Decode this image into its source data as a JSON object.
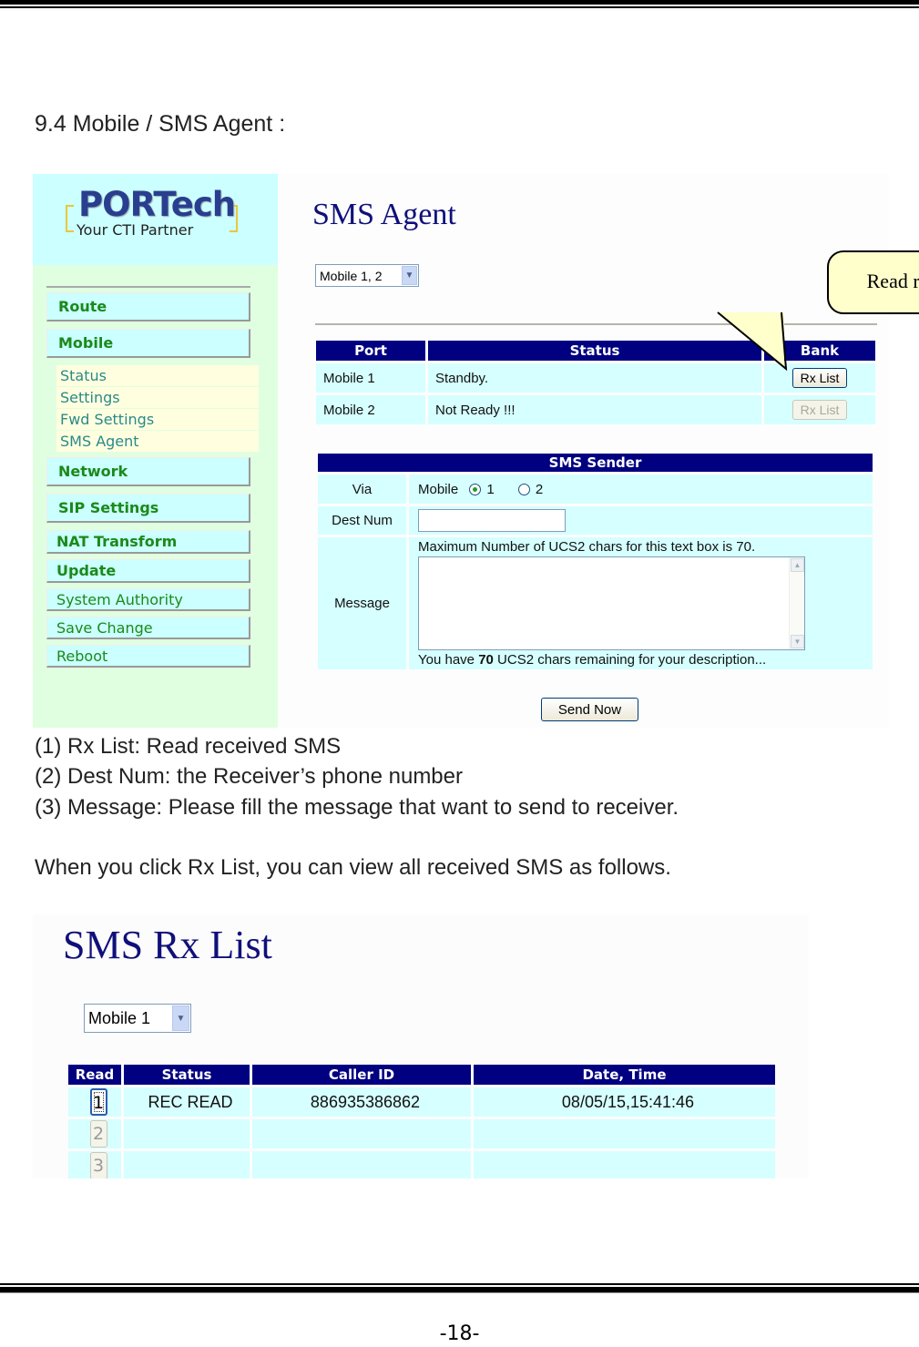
{
  "section_title": "9.4 Mobile / SMS Agent :",
  "sms_agent_screen": {
    "logo": {
      "brand": "PORTech",
      "tagline": "Your CTI Partner"
    },
    "sidebar": {
      "items": [
        {
          "label": "Route"
        },
        {
          "label": "Mobile"
        },
        {
          "label": "Network"
        },
        {
          "label": "SIP Settings"
        },
        {
          "label": "NAT Transform"
        },
        {
          "label": "Update"
        },
        {
          "label": "System Authority"
        },
        {
          "label": "Save Change"
        },
        {
          "label": "Reboot"
        }
      ],
      "mobile_submenu": [
        {
          "label": "Status"
        },
        {
          "label": "Settings"
        },
        {
          "label": "Fwd Settings"
        },
        {
          "label": "SMS Agent"
        }
      ]
    },
    "title": "SMS Agent",
    "port_select": {
      "value": "Mobile 1, 2"
    },
    "callout": "Read received SMS",
    "port_table": {
      "headers": [
        "Port",
        "Status",
        "Bank"
      ],
      "rows": [
        {
          "port": "Mobile 1",
          "status": "Standby.",
          "button": "Rx List",
          "enabled": true
        },
        {
          "port": "Mobile 2",
          "status": "Not Ready !!!",
          "button": "Rx List",
          "enabled": false
        }
      ]
    },
    "sender": {
      "header": "SMS Sender",
      "via_label": "Via",
      "via_prefix": "Mobile",
      "via_options": [
        "1",
        "2"
      ],
      "via_selected": "1",
      "dest_label": "Dest Num",
      "dest_value": "",
      "message_label": "Message",
      "message_hint": "Maximum Number of UCS2 chars for this text box is 70.",
      "message_value": "",
      "remaining_prefix": "You have ",
      "remaining_count": "70",
      "remaining_suffix": " UCS2 chars remaining for your description...",
      "send_button": "Send Now"
    }
  },
  "descriptions": [
    "(1) Rx List: Read received SMS",
    "(2) Dest Num: the Receiver’s phone number",
    "(3) Message: Please fill the message that want to send to receiver."
  ],
  "followup": "When you click Rx List, you can view all received SMS as follows.",
  "rx_list_screen": {
    "title": "SMS Rx List",
    "port_select": {
      "value": "Mobile 1"
    },
    "headers": [
      "Read",
      "Status",
      "Caller ID",
      "Date, Time"
    ],
    "rows": [
      {
        "read": "1",
        "status": "REC READ",
        "caller_id": "886935386862",
        "datetime": "08/05/15,15:41:46"
      },
      {
        "read": "2",
        "status": "",
        "caller_id": "",
        "datetime": ""
      },
      {
        "read": "3",
        "status": "",
        "caller_id": "",
        "datetime": ""
      }
    ]
  },
  "page_number": "-18-",
  "colors": {
    "header_navy": "#000080",
    "cell_cyan": "#d6ffff",
    "sidebar_green": "#e0ffe0",
    "nav_text_green": "#1a8a1a",
    "title_navy": "#10107a",
    "callout_yellow": "#ffffcc"
  }
}
